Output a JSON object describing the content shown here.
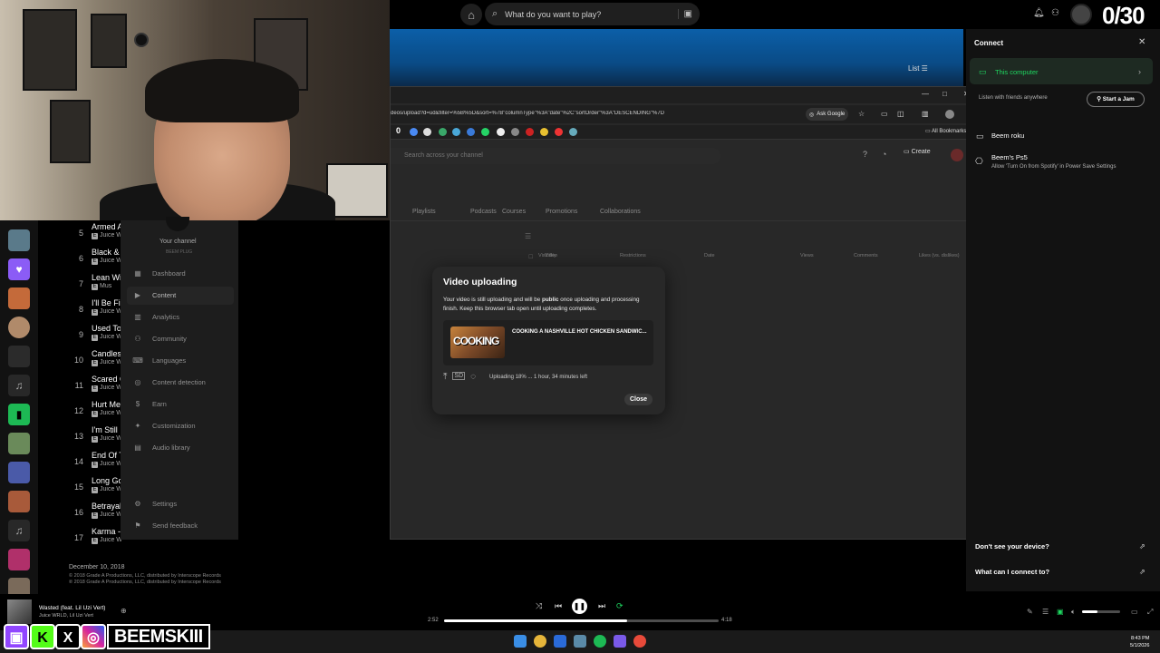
{
  "topbar": {
    "search_placeholder": "What do you want to play?",
    "counter": "0/30"
  },
  "banner": {
    "list_label": "List"
  },
  "tracks": [
    {
      "num": "5",
      "title": "Armed A",
      "artist": "Juice W"
    },
    {
      "num": "6",
      "title": "Black & W",
      "artist": "Juice W"
    },
    {
      "num": "7",
      "title": "Lean Wit",
      "artist": "Mus"
    },
    {
      "num": "8",
      "title": "I'll Be Fin",
      "artist": "Juice W"
    },
    {
      "num": "9",
      "title": "Used To",
      "artist": "Juice W"
    },
    {
      "num": "10",
      "title": "Candles",
      "artist": "Juice W"
    },
    {
      "num": "11",
      "title": "Scared O",
      "artist": "Juice W"
    },
    {
      "num": "12",
      "title": "Hurt Me",
      "artist": "Juice W"
    },
    {
      "num": "13",
      "title": "I'm Still",
      "artist": "Juice W"
    },
    {
      "num": "14",
      "title": "End Of Th",
      "artist": "Juice W"
    },
    {
      "num": "15",
      "title": "Long Go",
      "artist": "Juice W"
    },
    {
      "num": "16",
      "title": "Betrayal",
      "artist": "Juice W"
    },
    {
      "num": "17",
      "title": "Karma - S",
      "artist": "Juice W"
    }
  ],
  "album_footer": {
    "date": "December 10, 2018",
    "copy1": "© 2018 Grade A Productions, LLC, distributed by Interscope Records",
    "copy2": "℗ 2018 Grade A Productions, LLC, distributed by Interscope Records"
  },
  "browser": {
    "url": "deos/upload?d=ud&filter=%5B%5D&sort=%7B\"columnType\"%3A\"date\"%2C\"sortOrder\"%3A\"DESCENDING\"%7D",
    "ask_google": "Ask Google",
    "all_bookmarks": "All Bookmarks",
    "search_placeholder": "Search across your channel",
    "create_label": "Create",
    "tabs": [
      "Playlists",
      "Podcasts",
      "Courses",
      "Promotions",
      "Collaborations"
    ],
    "columns": [
      "Video",
      "Visibility",
      "Restrictions",
      "Date",
      "Views",
      "Comments",
      "Likes (vs. dislikes)"
    ]
  },
  "studio_sidebar": {
    "channel_label": "Your channel",
    "channel_name": "BEEM PLUG",
    "items": [
      "Dashboard",
      "Content",
      "Analytics",
      "Community",
      "Languages",
      "Content detection",
      "Earn",
      "Customization",
      "Audio library"
    ],
    "bottom_items": [
      "Settings",
      "Send feedback"
    ]
  },
  "dialog": {
    "title": "Video uploading",
    "message_before": "Your video is still uploading and will be ",
    "message_bold": "public",
    "message_after": " once uploading and processing finish. Keep this browser tab open until uploading completes.",
    "thumb_text": "COOKING",
    "video_title": "COOKING A NASHVILLE HOT CHICKEN SANDWIC...",
    "status": "Uploading 18% ... 1 hour, 34 minutes left",
    "progress": 0.18,
    "close_label": "Close"
  },
  "connect": {
    "title": "Connect",
    "this_computer": "This computer",
    "listen_with": "Listen with friends anywhere",
    "start_jam": "Start a Jam",
    "devices": [
      {
        "name": "Beem roku",
        "sub": ""
      },
      {
        "name": "Beem's Ps5",
        "sub": "Allow 'Turn On from Spotify' in Power Save Settings"
      }
    ],
    "footer1": "Don't see your device?",
    "footer2": "What can I connect to?"
  },
  "player": {
    "title": "Wasted (feat. Lil Uzi Vert)",
    "artist": "Juice WRLD, Lil Uzi Vert",
    "elapsed": "2:52",
    "duration": "4:18",
    "progress": 0.667,
    "volume": 0.4
  },
  "social": {
    "handle": "BEEMSKIII"
  },
  "taskbar": {
    "time": "8:43 PM",
    "date": "5/1/2026"
  },
  "colors": {
    "spotify_green": "#1ed760",
    "banner_blue": "#0b5fa8",
    "twitch": "#9146ff",
    "kick": "#53fc18"
  }
}
